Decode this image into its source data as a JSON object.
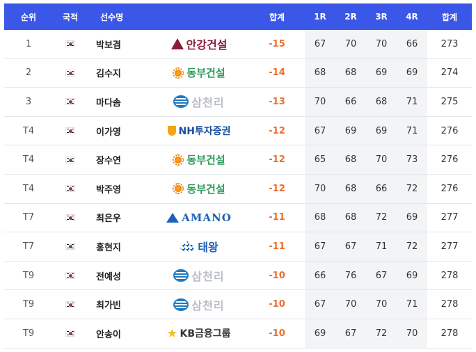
{
  "header": {
    "rank": "순위",
    "nationality": "국적",
    "player": "선수명",
    "total_to_par": "합계",
    "r1": "1R",
    "r2": "2R",
    "r3": "3R",
    "r4": "4R",
    "total_strokes": "합계"
  },
  "colors": {
    "header_bg": "#3a57e8",
    "to_par": "#ef6c2c",
    "round_column_shade": "#f3f4f6"
  },
  "rows": [
    {
      "rank": "1",
      "flag_icon": "korea-flag-icon",
      "name": "박보겸",
      "sponsor_icon": "ahngang-logo-icon",
      "sponsor": "안강건설",
      "to_par": "-15",
      "r1": "67",
      "r2": "70",
      "r3": "70",
      "r4": "66",
      "total": "273"
    },
    {
      "rank": "2",
      "flag_icon": "korea-flag-icon",
      "name": "김수지",
      "sponsor_icon": "dongbu-logo-icon",
      "sponsor": "동부건설",
      "to_par": "-14",
      "r1": "68",
      "r2": "68",
      "r3": "69",
      "r4": "69",
      "total": "274"
    },
    {
      "rank": "3",
      "flag_icon": "korea-flag-icon",
      "name": "마다솜",
      "sponsor_icon": "samchully-logo-icon",
      "sponsor": "삼천리",
      "to_par": "-13",
      "r1": "70",
      "r2": "66",
      "r3": "68",
      "r4": "71",
      "total": "275"
    },
    {
      "rank": "T4",
      "flag_icon": "korea-flag-icon",
      "name": "이가영",
      "sponsor_icon": "nh-logo-icon",
      "sponsor": "NH투자증권",
      "to_par": "-12",
      "r1": "67",
      "r2": "69",
      "r3": "69",
      "r4": "71",
      "total": "276"
    },
    {
      "rank": "T4",
      "flag_icon": "korea-flag-icon",
      "name": "장수연",
      "sponsor_icon": "dongbu-logo-icon",
      "sponsor": "동부건설",
      "to_par": "-12",
      "r1": "65",
      "r2": "68",
      "r3": "70",
      "r4": "73",
      "total": "276"
    },
    {
      "rank": "T4",
      "flag_icon": "korea-flag-icon",
      "name": "박주영",
      "sponsor_icon": "dongbu-logo-icon",
      "sponsor": "동부건설",
      "to_par": "-12",
      "r1": "70",
      "r2": "68",
      "r3": "66",
      "r4": "72",
      "total": "276"
    },
    {
      "rank": "T7",
      "flag_icon": "korea-flag-icon",
      "name": "최은우",
      "sponsor_icon": "amano-logo-icon",
      "sponsor": "AMANO",
      "to_par": "-11",
      "r1": "68",
      "r2": "68",
      "r3": "72",
      "r4": "69",
      "total": "277"
    },
    {
      "rank": "T7",
      "flag_icon": "korea-flag-icon",
      "name": "홍현지",
      "sponsor_icon": "taeyang-logo-icon",
      "sponsor": "태왕",
      "to_par": "-11",
      "r1": "67",
      "r2": "67",
      "r3": "71",
      "r4": "72",
      "total": "277"
    },
    {
      "rank": "T9",
      "flag_icon": "korea-flag-icon",
      "name": "전예성",
      "sponsor_icon": "samchully-logo-icon",
      "sponsor": "삼천리",
      "to_par": "-10",
      "r1": "66",
      "r2": "76",
      "r3": "67",
      "r4": "69",
      "total": "278"
    },
    {
      "rank": "T9",
      "flag_icon": "korea-flag-icon",
      "name": "최가빈",
      "sponsor_icon": "samchully-logo-icon",
      "sponsor": "삼천리",
      "to_par": "-10",
      "r1": "67",
      "r2": "70",
      "r3": "70",
      "r4": "71",
      "total": "278"
    },
    {
      "rank": "T9",
      "flag_icon": "korea-flag-icon",
      "name": "안송이",
      "sponsor_icon": "kb-logo-icon",
      "sponsor": "KB금융그룹",
      "to_par": "-10",
      "r1": "69",
      "r2": "67",
      "r3": "72",
      "r4": "70",
      "total": "278"
    }
  ]
}
